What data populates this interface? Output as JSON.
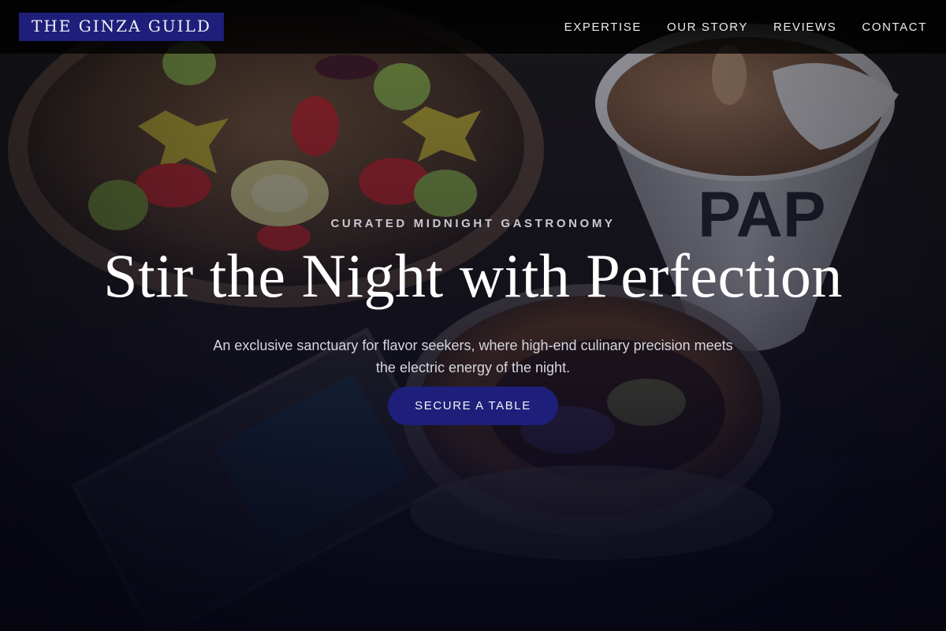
{
  "brand": {
    "name": "THE GINZA GUILD",
    "accent_color": "#1e1f7a"
  },
  "nav": {
    "items": [
      {
        "label": "EXPERTISE"
      },
      {
        "label": "OUR STORY"
      },
      {
        "label": "REVIEWS"
      },
      {
        "label": "CONTACT"
      }
    ]
  },
  "hero": {
    "eyebrow": "CURATED MIDNIGHT GASTRONOMY",
    "headline": "Stir the Night with Perfection",
    "subtext": "An exclusive sanctuary for flavor seekers, where high-end culinary precision meets the electric energy of the night.",
    "cta_label": "SECURE A TABLE",
    "background_image": "food-bowl-coffee-cup-dessert-photo"
  }
}
